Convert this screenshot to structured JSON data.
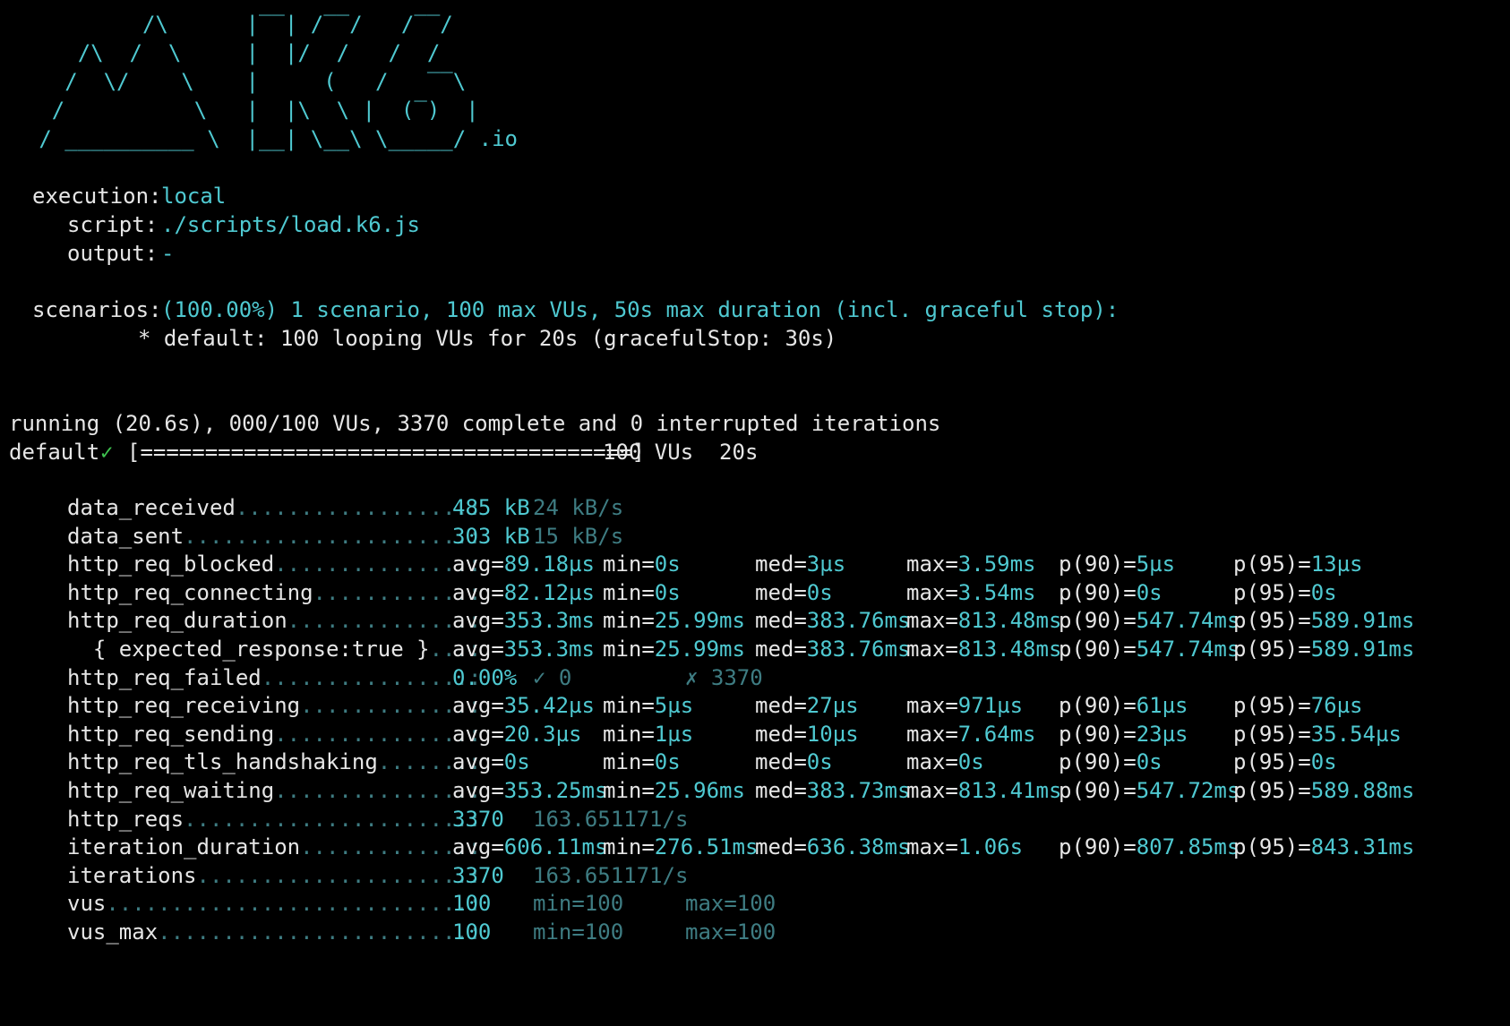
{
  "colors": {
    "background": "#000000",
    "text": "#e6e6e6",
    "accent": "#4fc9d1",
    "dim_accent": "#3e7c82",
    "check": "#3ec24f"
  },
  "logo": {
    "lines": [
      "           /\\      |‾‾| /‾‾/   /‾‾/",
      "      /\\  /  \\     |  |/  /   /  /",
      "     /  \\/    \\    |     (   /   ‾‾\\",
      "    /          \\   |  |\\  \\ |  (‾)  |",
      "   / __________ \\  |__| \\__\\ \\_____/ .io"
    ]
  },
  "run_info": {
    "execution_label": "execution:",
    "execution_value": "local",
    "script_label": "script:",
    "script_value": "./scripts/load.k6.js",
    "output_label": "output:",
    "output_value": "-",
    "scenarios_label": "scenarios:",
    "scenarios_value": "(100.00%) 1 scenario, 100 max VUs, 50s max duration (incl. graceful stop):",
    "default_scenario": "* default: 100 looping VUs for 20s (gracefulStop: 30s)"
  },
  "progress": {
    "running_line": "running (20.6s), 000/100 VUs, 3370 complete and 0 interrupted iterations",
    "default_label": "default",
    "check_mark": "✓",
    "bar": "[======================================]",
    "summary": "100 VUs  20s",
    "fraction": 1.0
  },
  "metrics": [
    {
      "name": "data_received",
      "dots": "..................:",
      "cells": [
        {
          "t": "485 kB",
          "c": "cyan"
        },
        {
          "t": "24 kB/s",
          "c": "dim"
        }
      ]
    },
    {
      "name": "data_sent",
      "dots": "......................:",
      "cells": [
        {
          "t": "303 kB",
          "c": "cyan"
        },
        {
          "t": "15 kB/s",
          "c": "dim"
        }
      ]
    },
    {
      "name": "http_req_blocked",
      "dots": "...............:",
      "cells": [
        {
          "l": "avg=",
          "v": "89.18µs"
        },
        {
          "l": "min=",
          "v": "0s"
        },
        {
          "l": "med=",
          "v": "3µs"
        },
        {
          "l": "max=",
          "v": "3.59ms"
        },
        {
          "l": "p(90)=",
          "v": "5µs"
        },
        {
          "l": "p(95)=",
          "v": "13µs"
        }
      ]
    },
    {
      "name": "http_req_connecting",
      "dots": "............:",
      "cells": [
        {
          "l": "avg=",
          "v": "82.12µs"
        },
        {
          "l": "min=",
          "v": "0s"
        },
        {
          "l": "med=",
          "v": "0s"
        },
        {
          "l": "max=",
          "v": "3.54ms"
        },
        {
          "l": "p(90)=",
          "v": "0s"
        },
        {
          "l": "p(95)=",
          "v": "0s"
        }
      ]
    },
    {
      "name": "http_req_duration",
      "dots": "..............:",
      "cells": [
        {
          "l": "avg=",
          "v": "353.3ms"
        },
        {
          "l": "min=",
          "v": "25.99ms"
        },
        {
          "l": "med=",
          "v": "383.76ms"
        },
        {
          "l": "max=",
          "v": "813.48ms"
        },
        {
          "l": "p(90)=",
          "v": "547.74ms"
        },
        {
          "l": "p(95)=",
          "v": "589.91ms"
        }
      ]
    },
    {
      "name": "  { expected_response:true }",
      "dots": "...:",
      "cells": [
        {
          "l": "avg=",
          "v": "353.3ms"
        },
        {
          "l": "min=",
          "v": "25.99ms"
        },
        {
          "l": "med=",
          "v": "383.76ms"
        },
        {
          "l": "max=",
          "v": "813.48ms"
        },
        {
          "l": "p(90)=",
          "v": "547.74ms"
        },
        {
          "l": "p(95)=",
          "v": "589.91ms"
        }
      ]
    },
    {
      "name": "http_req_failed",
      "dots": "................:",
      "cells": [
        {
          "t": "0.00%",
          "c": "cyan"
        },
        {
          "t": "✓ 0",
          "c": "dim"
        },
        {
          "t": "✗ 3370",
          "c": "dim"
        }
      ]
    },
    {
      "name": "http_req_receiving",
      "dots": ".............:",
      "cells": [
        {
          "l": "avg=",
          "v": "35.42µs"
        },
        {
          "l": "min=",
          "v": "5µs"
        },
        {
          "l": "med=",
          "v": "27µs"
        },
        {
          "l": "max=",
          "v": "971µs"
        },
        {
          "l": "p(90)=",
          "v": "61µs"
        },
        {
          "l": "p(95)=",
          "v": "76µs"
        }
      ]
    },
    {
      "name": "http_req_sending",
      "dots": "...............:",
      "cells": [
        {
          "l": "avg=",
          "v": "20.3µs"
        },
        {
          "l": "min=",
          "v": "1µs"
        },
        {
          "l": "med=",
          "v": "10µs"
        },
        {
          "l": "max=",
          "v": "7.64ms"
        },
        {
          "l": "p(90)=",
          "v": "23µs"
        },
        {
          "l": "p(95)=",
          "v": "35.54µs"
        }
      ]
    },
    {
      "name": "http_req_tls_handshaking",
      "dots": ".......:",
      "cells": [
        {
          "l": "avg=",
          "v": "0s"
        },
        {
          "l": "min=",
          "v": "0s"
        },
        {
          "l": "med=",
          "v": "0s"
        },
        {
          "l": "max=",
          "v": "0s"
        },
        {
          "l": "p(90)=",
          "v": "0s"
        },
        {
          "l": "p(95)=",
          "v": "0s"
        }
      ]
    },
    {
      "name": "http_req_waiting",
      "dots": "...............:",
      "cells": [
        {
          "l": "avg=",
          "v": "353.25ms"
        },
        {
          "l": "min=",
          "v": "25.96ms"
        },
        {
          "l": "med=",
          "v": "383.73ms"
        },
        {
          "l": "max=",
          "v": "813.41ms"
        },
        {
          "l": "p(90)=",
          "v": "547.72ms"
        },
        {
          "l": "p(95)=",
          "v": "589.88ms"
        }
      ]
    },
    {
      "name": "http_reqs",
      "dots": "......................:",
      "cells": [
        {
          "t": "3370",
          "c": "cyan"
        },
        {
          "t": "163.651171/s",
          "c": "dim"
        }
      ]
    },
    {
      "name": "iteration_duration",
      "dots": ".............:",
      "cells": [
        {
          "l": "avg=",
          "v": "606.11ms"
        },
        {
          "l": "min=",
          "v": "276.51ms"
        },
        {
          "l": "med=",
          "v": "636.38ms"
        },
        {
          "l": "max=",
          "v": "1.06s"
        },
        {
          "l": "p(90)=",
          "v": "807.85ms"
        },
        {
          "l": "p(95)=",
          "v": "843.31ms"
        }
      ]
    },
    {
      "name": "iterations",
      "dots": ".....................:",
      "cells": [
        {
          "t": "3370",
          "c": "cyan"
        },
        {
          "t": "163.651171/s",
          "c": "dim"
        }
      ]
    },
    {
      "name": "vus",
      "dots": "............................:",
      "cells": [
        {
          "t": "100",
          "c": "cyan"
        },
        {
          "t": "min=100",
          "c": "dim"
        },
        {
          "t": "max=100",
          "c": "dim"
        }
      ]
    },
    {
      "name": "vus_max",
      "dots": "........................:",
      "cells": [
        {
          "t": "100",
          "c": "cyan"
        },
        {
          "t": "min=100",
          "c": "dim"
        },
        {
          "t": "max=100",
          "c": "dim"
        }
      ]
    }
  ]
}
